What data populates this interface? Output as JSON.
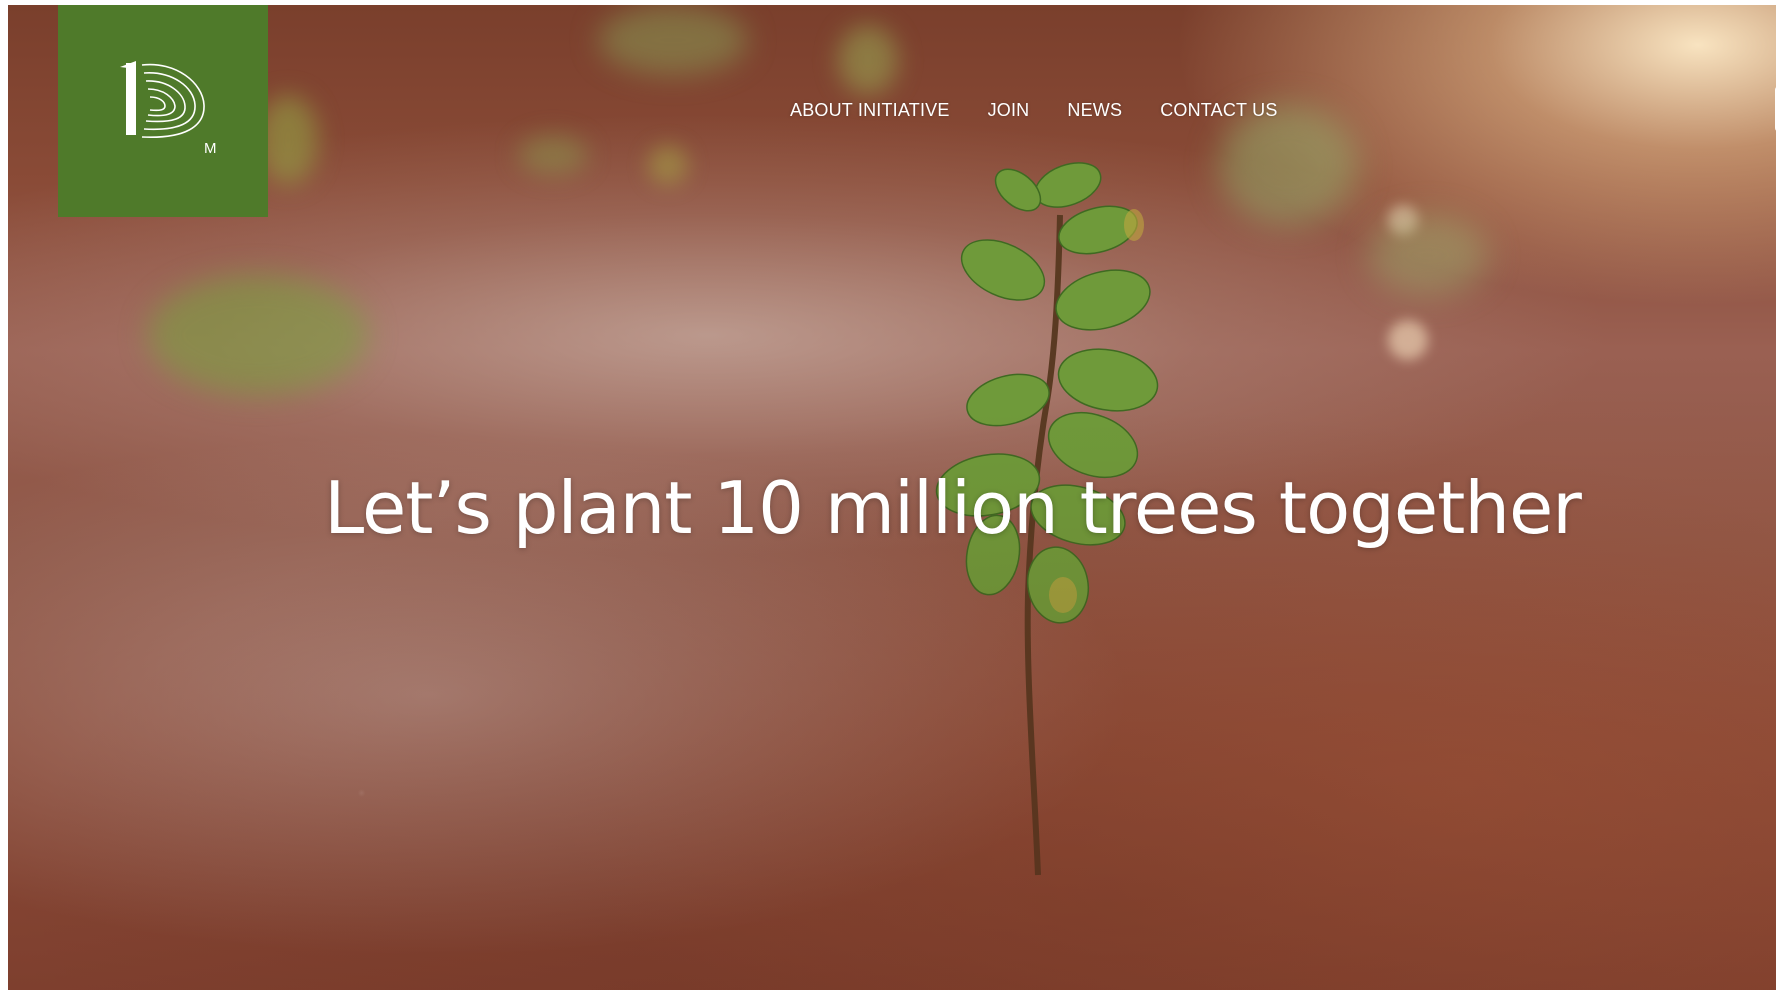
{
  "brand": {
    "logo_name": "1m-logo",
    "logo_color": "#4f7a2a",
    "logo_letter": "M"
  },
  "nav": {
    "items": [
      {
        "label": "ABOUT INITIATIVE"
      },
      {
        "label": "JOIN"
      },
      {
        "label": "NEWS"
      },
      {
        "label": "CONTACT US"
      }
    ]
  },
  "hero": {
    "headline": "Let’s plant 10 million trees together"
  },
  "colors": {
    "nav_text": "#ffffff",
    "headline_text": "#ffffff"
  }
}
